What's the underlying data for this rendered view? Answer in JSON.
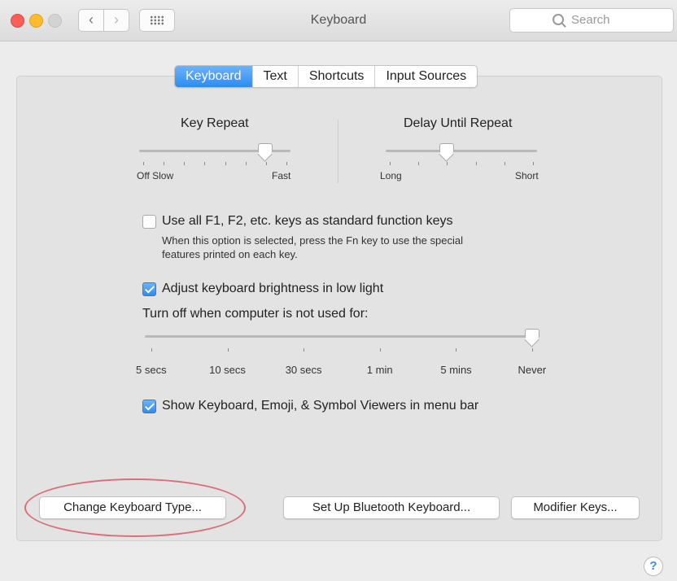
{
  "window": {
    "title": "Keyboard"
  },
  "toolbar": {
    "back_glyph": "‹",
    "forward_glyph": "›",
    "grid_icon": "show-all-grid-icon"
  },
  "search": {
    "placeholder": "Search"
  },
  "tabs": [
    {
      "label": "Keyboard",
      "active": true
    },
    {
      "label": "Text",
      "active": false
    },
    {
      "label": "Shortcuts",
      "active": false
    },
    {
      "label": "Input Sources",
      "active": false
    }
  ],
  "key_repeat": {
    "title": "Key Repeat",
    "min_label": "Off Slow",
    "max_label": "Fast",
    "ticks": 8,
    "value_fraction": 0.85
  },
  "delay_until_repeat": {
    "title": "Delay Until Repeat",
    "min_label": "Long",
    "max_label": "Short",
    "ticks": 6,
    "value_fraction": 0.4
  },
  "fn_keys": {
    "label": "Use all F1, F2, etc. keys as standard function keys",
    "checked": false,
    "note_line1": "When this option is selected, press the Fn key to use the special",
    "note_line2": "features printed on each key."
  },
  "brightness": {
    "label": "Adjust keyboard brightness in low light",
    "checked": true
  },
  "turn_off": {
    "label": "Turn off when computer is not used for:",
    "stops": [
      "5 secs",
      "10 secs",
      "30 secs",
      "1 min",
      "5 mins",
      "Never"
    ],
    "selected": "Never"
  },
  "viewers": {
    "label": "Show Keyboard, Emoji, & Symbol Viewers in menu bar",
    "checked": true
  },
  "buttons": {
    "change_type": "Change Keyboard Type...",
    "bluetooth": "Set Up Bluetooth Keyboard...",
    "modifier": "Modifier Keys..."
  },
  "help": {
    "glyph": "?"
  },
  "colors": {
    "accent": "#2d8cf0",
    "annotation_ellipse": "#d8707a"
  }
}
